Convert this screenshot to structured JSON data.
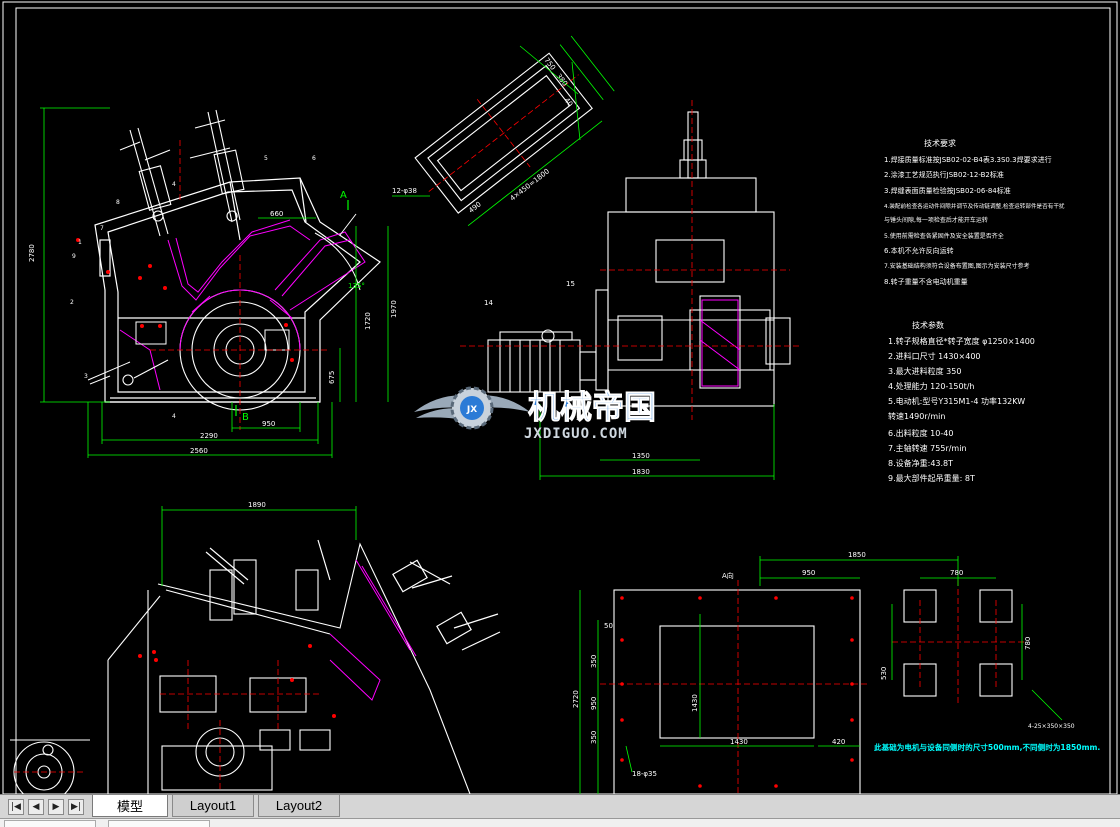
{
  "drawing": {
    "tech_requirements": {
      "title": "技术要求",
      "items": [
        "1.焊接质量标准按JSB02-02-B4表3.3S0.3焊要求进行",
        "2.涂漆工艺规范执行JSB02-12-B2标准",
        "3.焊缝表面质量检验按JSB02-06-84标准",
        "4.装配前检查各运动件间隙并调节及传动链调整,检查运转部件是否有干扰",
        "  与锤头间隙,每一项检查后才能开车运转",
        "5.使用前需检查各紧固件及安全装置是否齐全",
        "6.本机不允许反向运转",
        "7.安装基础结构须符合设备布置图,图示为安装尺寸参考",
        "8.转子重量不含电动机重量"
      ]
    },
    "tech_params": {
      "title": "技术参数",
      "items": [
        "1.转子规格直径*转子宽度  φ1250×1400",
        "2.进料口尺寸    1430×400",
        "3.最大进料粒度    350",
        "4.处理能力    120-150t/h",
        "5.电动机:型号Y315M1-4 功率132KW",
        "  转速1490r/min",
        "6.出料粒度  10-40",
        "7.主轴转速   755r/min",
        "8.设备净重:43.8T",
        "9.最大部件起吊重量: 8T"
      ]
    },
    "foundation_note": "此基础为电机与设备同侧时的尺寸500mm,不同侧时为1850mm.",
    "dimensions": {
      "front_2780": "2780",
      "front_2290": "2290",
      "front_2560": "2560",
      "front_950": "950",
      "front_1720": "1720",
      "front_1970": "1970",
      "front_675": "675",
      "front_660": "660",
      "front_135": "135°",
      "side_1350": "1350",
      "side_1830": "1830",
      "top_1890": "1890",
      "found_1850": "1850",
      "found_950": "950",
      "found_780a": "780",
      "found_780b": "780",
      "found_530": "530",
      "found_1430a": "1430",
      "found_1430b": "1430",
      "found_420": "420",
      "found_2720": "2720",
      "found_350a": "350",
      "found_350b": "350",
      "found_50": "50",
      "found_950b": "950",
      "found_bolt": "18-φ35",
      "found_bolt2": "4-25×350×350",
      "detail_1": "12-φ38",
      "detail_2": "4×450=1800",
      "detail_3": "750",
      "detail_4": "490",
      "detail_5": "380",
      "detail_6": "40",
      "section_a": "A",
      "section_b": "B",
      "title_a": "A向"
    }
  },
  "watermark": {
    "brand_cn": "机械帝国",
    "domain": "JXDIGUO.COM",
    "badge": "JX",
    "colors": {
      "text": "#2b7bd6",
      "wing": "#9aa9b8"
    }
  },
  "tabs": [
    {
      "label": "模型",
      "active": true
    },
    {
      "label": "Layout1",
      "active": false
    },
    {
      "label": "Layout2",
      "active": false
    }
  ],
  "colors": {
    "background": "#000000",
    "outline": "#ffffff",
    "dimension": "#00ff00",
    "centerline": "#ff0000",
    "hatch": "#ff00ff",
    "text": "#ffffff",
    "note_text": "#00ffff",
    "yellow": "#ffff00"
  }
}
